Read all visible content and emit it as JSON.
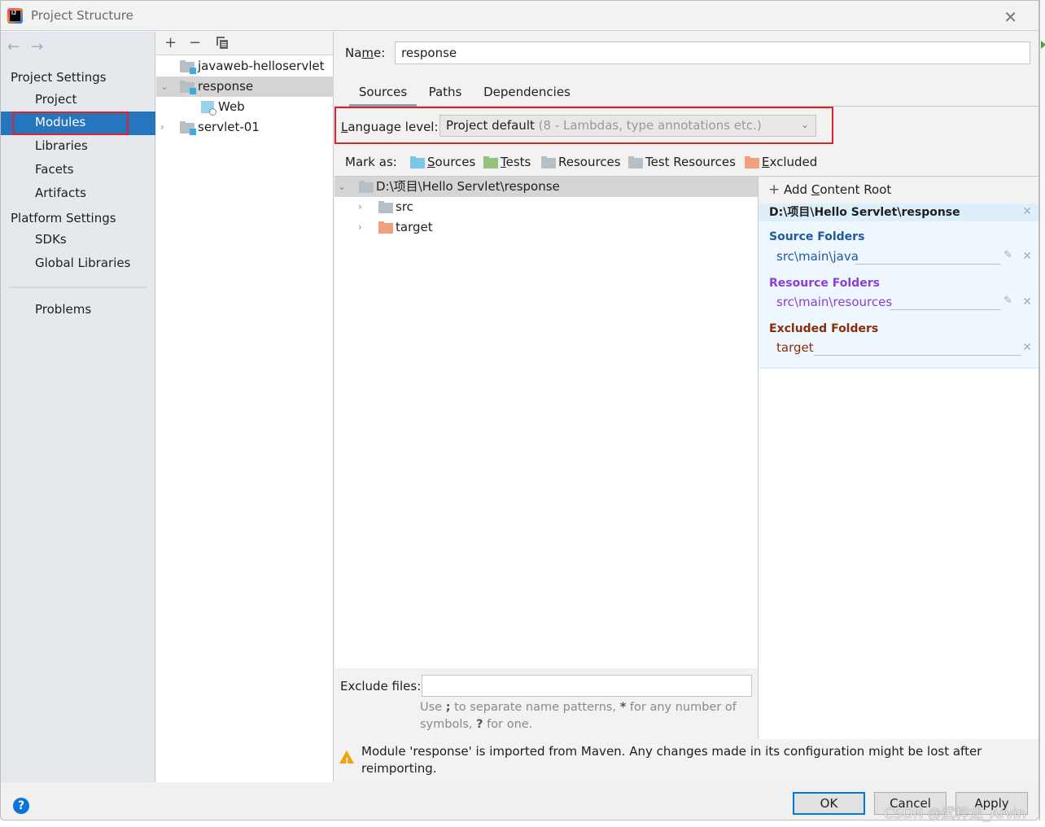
{
  "window": {
    "title": "Project Structure",
    "app_icon": "intellij-logo",
    "app_icon_text": "IJ",
    "close_icon": "close-icon"
  },
  "nav": {
    "back_icon": "arrow-left-icon",
    "forward_icon": "arrow-right-icon",
    "arrows": "← →"
  },
  "sidebar": {
    "project_settings_label": "Project Settings",
    "project_items": [
      {
        "label": "Project",
        "selected": false
      },
      {
        "label": "Modules",
        "selected": true
      },
      {
        "label": "Libraries",
        "selected": false
      },
      {
        "label": "Facets",
        "selected": false
      },
      {
        "label": "Artifacts",
        "selected": false
      }
    ],
    "platform_settings_label": "Platform Settings",
    "platform_items": [
      {
        "label": "SDKs"
      },
      {
        "label": "Global Libraries"
      }
    ],
    "problems_label": "Problems"
  },
  "modules_panel": {
    "toolbar": {
      "add": "+",
      "remove": "−",
      "copy_icon": "copy-icon"
    },
    "items": [
      {
        "label": "javaweb-helloservlet",
        "expanded": null,
        "selected": false
      },
      {
        "label": "response",
        "expanded": true,
        "selected": true
      },
      {
        "label": "Web",
        "child": true
      },
      {
        "label": "servlet-01",
        "expanded": false,
        "selected": false
      }
    ]
  },
  "module": {
    "name_label_pre": "Na",
    "name_label_u": "m",
    "name_label_post": "e:",
    "name_value": "response",
    "tabs": [
      {
        "label": "Sources",
        "active": true
      },
      {
        "label": "Paths",
        "active": false
      },
      {
        "label": "Dependencies",
        "active": false
      }
    ],
    "language_level_label_u": "L",
    "language_level_label_rest": "anguage level:",
    "language_level_value": "Project default",
    "language_level_hint": "(8 - Lambdas, type annotations etc.)",
    "mark_as_label": "Mark as:",
    "mark_as": [
      {
        "u": "S",
        "rest": "ources",
        "color": "#7ec6e9"
      },
      {
        "u": "T",
        "rest": "ests",
        "color": "#93c47d"
      },
      {
        "u": "",
        "rest": "Resources",
        "color": "#b6bec6"
      },
      {
        "u": "",
        "rest": "Test Resources",
        "color": "#b6bec6"
      },
      {
        "u": "E",
        "rest": "xcluded",
        "color": "#f0a07c"
      }
    ],
    "tree": [
      {
        "label": "D:\\项目\\Hello Servlet\\response",
        "expanded": true,
        "selected": true,
        "color": "#b6bec6"
      },
      {
        "label": "src",
        "expanded": false,
        "color": "#b6bec6"
      },
      {
        "label": "target",
        "expanded": false,
        "color": "#f0a07c"
      }
    ],
    "content_roots": {
      "add_label_pre": "Add ",
      "add_label_u": "C",
      "add_label_post": "ontent Root",
      "root_path": "D:\\项目\\Hello Servlet\\response",
      "sections": [
        {
          "title": "Source Folders",
          "path": "src\\main\\java",
          "color": "#1d5a9e",
          "editable": true
        },
        {
          "title": "Resource Folders",
          "path": "src\\main\\resources",
          "color": "#8a3fd6",
          "editable": true
        },
        {
          "title": "Excluded Folders",
          "path": "target",
          "color": "#8a2e0a",
          "editable": false
        }
      ]
    },
    "exclude_files_label": "Exclude files:",
    "exclude_files_value": "",
    "exclude_hint_1": "Use ",
    "exclude_hint_semi": ";",
    "exclude_hint_2": " to separate name patterns, ",
    "exclude_hint_star": "*",
    "exclude_hint_3": " for any number of symbols, ",
    "exclude_hint_q": "?",
    "exclude_hint_4": " for one.",
    "warning": "Module 'response' is imported from Maven. Any changes made in its configuration might be lost after reimporting."
  },
  "footer": {
    "help": "?",
    "ok": "OK",
    "cancel": "Cancel",
    "apply": "Apply"
  },
  "watermark": "CSDN @武梓龙_Arvin"
}
